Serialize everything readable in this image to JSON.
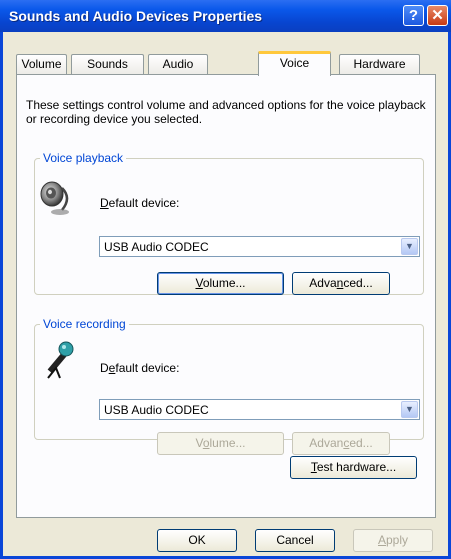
{
  "window": {
    "title": "Sounds and Audio Devices Properties",
    "help_glyph": "?",
    "close_glyph": "✕"
  },
  "tabs": [
    {
      "label": "Volume"
    },
    {
      "label": "Sounds"
    },
    {
      "label": "Audio"
    },
    {
      "label": "Voice",
      "active": true
    },
    {
      "label": "Hardware"
    }
  ],
  "description": "These settings control volume and advanced options for the voice playback or recording device you selected.",
  "voice_playback": {
    "legend": "Voice playback",
    "icon": "speaker-icon",
    "default_device_label": "Default device:",
    "device_value": "USB Audio CODEC",
    "volume_button": "Volume...",
    "advanced_button": "Advanced...",
    "buttons_enabled": true
  },
  "voice_recording": {
    "legend": "Voice recording",
    "icon": "microphone-icon",
    "default_device_label": "Default device:",
    "device_value": "USB Audio CODEC",
    "volume_button": "Volume...",
    "advanced_button": "Advanced...",
    "buttons_enabled": false
  },
  "test_hardware_button": "Test hardware...",
  "footer": {
    "ok": "OK",
    "cancel": "Cancel",
    "apply": "Apply",
    "apply_enabled": false
  },
  "colors": {
    "titlebar": "#0a58ea",
    "tab_highlight": "#ffc83c",
    "group_legend": "#0046d5",
    "dialog_bg": "#ece9d8"
  }
}
